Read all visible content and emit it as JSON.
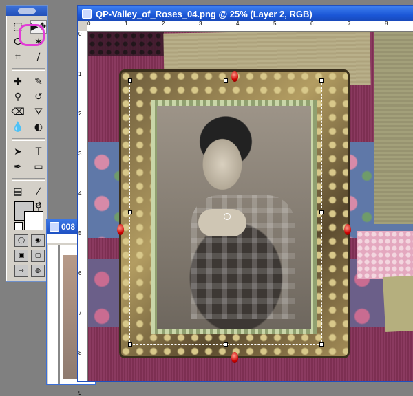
{
  "window": {
    "title": "QP-Valley_of_Roses_04.png @ 25% (Layer 2, RGB)"
  },
  "second_window": {
    "title": "008"
  },
  "ruler": {
    "h_labels": [
      "0",
      "1",
      "2",
      "3",
      "4",
      "5",
      "6",
      "7",
      "8"
    ],
    "v_labels": [
      "0",
      "1",
      "2",
      "3",
      "4",
      "5",
      "6",
      "7",
      "8",
      "9"
    ]
  },
  "toolbox": {
    "selected_tool": "move-tool",
    "highlight_color": "#e23cd6",
    "tools": [
      {
        "name": "marquee-tool",
        "glyph": "⬚"
      },
      {
        "name": "move-tool",
        "glyph": "▶✥"
      },
      {
        "name": "lasso-tool",
        "glyph": "ⵔ"
      },
      {
        "name": "magic-wand-tool",
        "glyph": "✶"
      },
      {
        "name": "crop-tool",
        "glyph": "⌗"
      },
      {
        "name": "slice-tool",
        "glyph": "∕"
      },
      {
        "name": "healing-brush-tool",
        "glyph": "✚"
      },
      {
        "name": "brush-tool",
        "glyph": "✎"
      },
      {
        "name": "clone-stamp-tool",
        "glyph": "⚲"
      },
      {
        "name": "history-brush-tool",
        "glyph": "↺"
      },
      {
        "name": "eraser-tool",
        "glyph": "⌫"
      },
      {
        "name": "paint-bucket-tool",
        "glyph": "⛛"
      },
      {
        "name": "blur-tool",
        "glyph": "💧"
      },
      {
        "name": "dodge-tool",
        "glyph": "◐"
      },
      {
        "name": "path-selection-tool",
        "glyph": "➤"
      },
      {
        "name": "type-tool",
        "glyph": "T"
      },
      {
        "name": "pen-tool",
        "glyph": "✒"
      },
      {
        "name": "shape-tool",
        "glyph": "▭"
      },
      {
        "name": "notes-tool",
        "glyph": "▤"
      },
      {
        "name": "eyedropper-tool",
        "glyph": "⁄"
      },
      {
        "name": "hand-tool",
        "glyph": "✋"
      },
      {
        "name": "zoom-tool",
        "glyph": "⚲"
      }
    ],
    "foreground_color": "#c8c8c8",
    "background_color": "#ffffff"
  }
}
